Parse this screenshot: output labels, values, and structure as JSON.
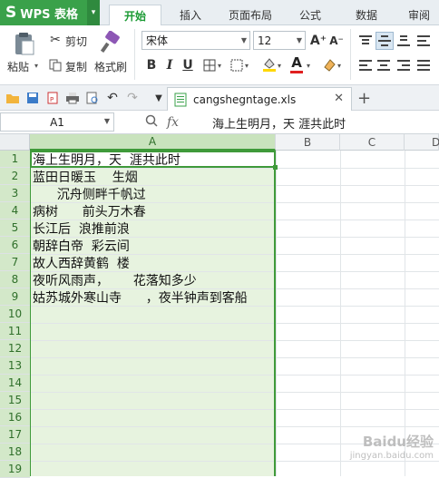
{
  "app": {
    "name": "WPS 表格",
    "logo_glyph": "S",
    "accent": "#3aa14a"
  },
  "ribbon_tabs": [
    "开始",
    "插入",
    "页面布局",
    "公式",
    "数据",
    "审阅"
  ],
  "active_tab": "开始",
  "ribbon": {
    "clipboard": {
      "paste": "粘贴",
      "cut": "剪切",
      "copy": "复制",
      "format_painter": "格式刷"
    },
    "font": {
      "name": "宋体",
      "size": "12",
      "bold": "B",
      "italic": "I",
      "underline": "U",
      "grow": "A⁺",
      "shrink": "A⁻",
      "font_color_glyph": "A"
    }
  },
  "document": {
    "filename": "cangshegntage.xls"
  },
  "formula_bar": {
    "name_box": "A1",
    "fx": "fx",
    "content": "海上生明月，天  涯共此时"
  },
  "sheet": {
    "columns": [
      "A",
      "B",
      "C",
      "D"
    ],
    "selected_column": "A",
    "row_numbers": [
      "1",
      "2",
      "3",
      "4",
      "5",
      "6",
      "7",
      "8",
      "9",
      "10",
      "11",
      "12",
      "13",
      "14",
      "15",
      "16",
      "17",
      "18",
      "19"
    ],
    "cells_A": [
      "海上生明月，天  涯共此时",
      "蓝田日暖玉    生烟",
      "      沉舟侧畔千帆过",
      "病树      前头万木春",
      "长江后  浪推前浪",
      "朝辞白帝  彩云间",
      "故人西辞黄鹤  楼",
      "夜听风雨声，      花落知多少",
      "姑苏城外寒山寺      ，夜半钟声到客船"
    ]
  },
  "watermark": {
    "line1": "Baidu经验",
    "line2": "jingyan.baidu.com"
  }
}
